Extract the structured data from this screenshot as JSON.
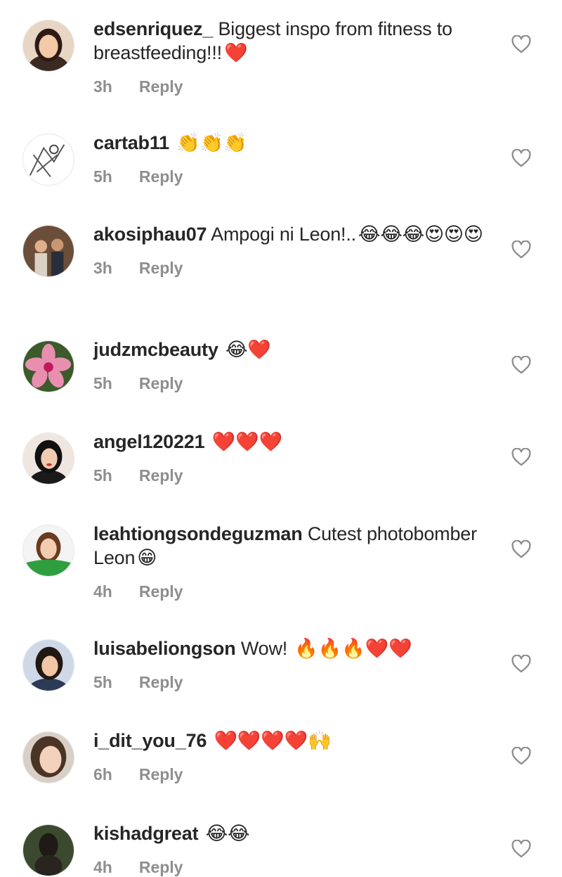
{
  "reply_label": "Reply",
  "comments": [
    {
      "username": "edsenriquez_",
      "text": " Biggest inspo from fitness to breastfeeding!!!",
      "emoji": "❤️",
      "time": "3h"
    },
    {
      "username": "cartab11",
      "text": " ",
      "emoji": "👏👏👏",
      "time": "5h"
    },
    {
      "username": "akosiphau07",
      "text": " Ampogi ni Leon!..",
      "emoji": "😂😂😂😍😍😍",
      "time": "3h"
    },
    {
      "username": "judzmcbeauty",
      "text": " ",
      "emoji": "😂❤️",
      "time": "5h"
    },
    {
      "username": "angel120221",
      "text": " ",
      "emoji": "❤️❤️❤️",
      "time": "5h"
    },
    {
      "username": "leahtiongsondeguzman",
      "text": " Cutest photobomber Leon",
      "emoji": "😁",
      "time": "4h"
    },
    {
      "username": "luisabeliongson",
      "text": " Wow! ",
      "emoji": "🔥🔥🔥❤️❤️",
      "time": "5h"
    },
    {
      "username": "i_dit_you_76",
      "text": " ",
      "emoji": "❤️❤️❤️❤️🙌",
      "time": "6h"
    },
    {
      "username": "kishadgreat",
      "text": " ",
      "emoji": "😂😂",
      "time": "4h"
    }
  ],
  "colors": {
    "text": "#262626",
    "meta": "#8e8e8e",
    "heart_outline": "#8e8e8e"
  },
  "icons": {
    "like": "heart-outline-icon",
    "avatar": "profile-picture"
  }
}
